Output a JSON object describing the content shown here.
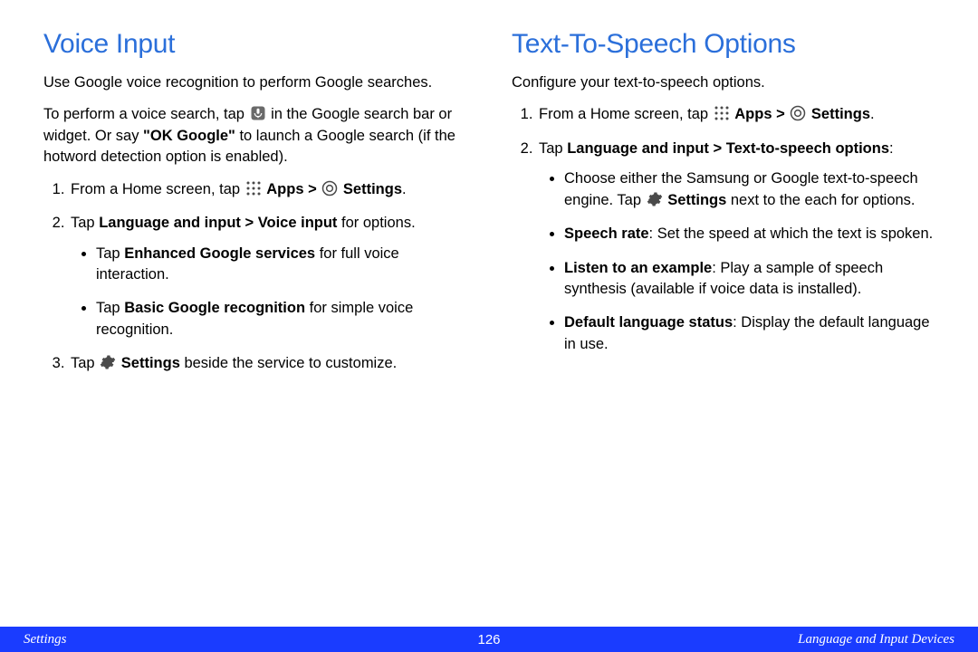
{
  "left": {
    "heading": "Voice Input",
    "p1": "Use Google voice recognition to perform Google searches.",
    "p2a": "To perform a voice search, tap ",
    "p2b": " in the Google search bar or widget. Or say ",
    "p2c": "\"OK Google\"",
    "p2d": " to launch a Google search (if the hotword detection option is enabled).",
    "li1a": "From a Home screen, tap ",
    "li1b": "Apps > ",
    "li1c": "Settings",
    "li1d": ".",
    "li2a": "Tap ",
    "li2b": "Language and input > Voice input",
    "li2c": " for options.",
    "li2_b1a": "Tap ",
    "li2_b1b": "Enhanced Google services",
    "li2_b1c": " for full voice interaction.",
    "li2_b2a": "Tap ",
    "li2_b2b": "Basic Google recognition",
    "li2_b2c": " for simple voice recognition.",
    "li3a": "Tap ",
    "li3b": "Settings",
    "li3c": " beside the service to customize."
  },
  "right": {
    "heading": "Text-To-Speech Options",
    "p1": "Configure your text-to-speech options.",
    "li1a": "From a Home screen, tap ",
    "li1b": "Apps > ",
    "li1c": "Settings",
    "li1d": ".",
    "li2a": "Tap ",
    "li2b": "Language and input > Text-to-speech options",
    "li2c": ":",
    "li2_b1a": "Choose either the Samsung or Google text-to-speech engine. Tap ",
    "li2_b1b": "Settings",
    "li2_b1c": " next to the each for options.",
    "li2_b2a": "Speech rate",
    "li2_b2b": ": Set the speed at which the text is spoken.",
    "li2_b3a": "Listen to an example",
    "li2_b3b": ": Play a sample of speech synthesis (available if voice data is installed).",
    "li2_b4a": "Default language status",
    "li2_b4b": ": Display the default language in use."
  },
  "footer": {
    "left": "Settings",
    "center": "126",
    "right": "Language and Input Devices"
  }
}
